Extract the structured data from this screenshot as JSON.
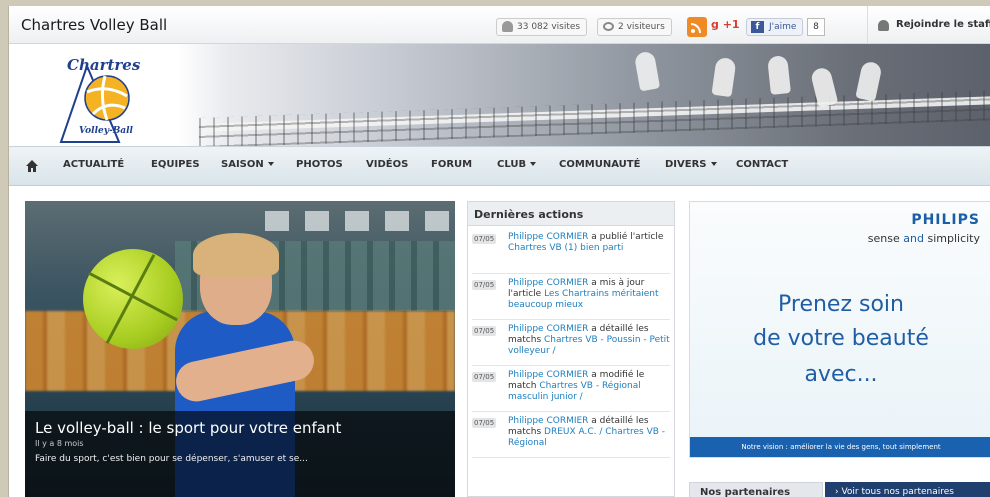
{
  "header": {
    "site_title": "Chartres Volley Ball",
    "visits": "33 082 visites",
    "visitors": "2 visiteurs",
    "gplus_label": "+1",
    "fb_like": "J'aime",
    "fb_count": "8",
    "join_label": "Rejoindre le staff"
  },
  "logo": {
    "top": "Chartres",
    "bottom": "Volley-Ball"
  },
  "nav": {
    "items": [
      {
        "label": "ACTUALITÉ"
      },
      {
        "label": "EQUIPES"
      },
      {
        "label": "SAISON"
      },
      {
        "label": "PHOTOS"
      },
      {
        "label": "VIDÉOS"
      },
      {
        "label": "FORUM"
      },
      {
        "label": "CLUB"
      },
      {
        "label": "COMMUNAUTÉ"
      },
      {
        "label": "DIVERS"
      },
      {
        "label": "CONTACT"
      }
    ]
  },
  "hero": {
    "title": "Le volley-ball : le sport pour votre enfant",
    "time": "Il y a 8 mois",
    "text": "Faire du sport, c'est bien pour se dépenser, s'amuser et se..."
  },
  "actions": {
    "heading": "Dernières actions",
    "items": [
      {
        "date": "07/05",
        "user": "Philippe CORMIER",
        "verb": " a publié l'article ",
        "target": "Chartres VB (1) bien parti"
      },
      {
        "date": "07/05",
        "user": "Philippe CORMIER",
        "verb": " a mis à jour l'article ",
        "target": "Les Chartrains méritaient beaucoup mieux"
      },
      {
        "date": "07/05",
        "user": "Philippe CORMIER",
        "verb": " a détaillé les matchs ",
        "target": "Chartres VB - Poussin - Petit volleyeur /"
      },
      {
        "date": "07/05",
        "user": "Philippe CORMIER",
        "verb": " a modifié le match ",
        "target": "Chartres VB - Régional masculin junior /"
      },
      {
        "date": "07/05",
        "user": "Philippe CORMIER",
        "verb": " a détaillé les matchs ",
        "target": "DREUX A.C. / Chartres VB - Régional"
      }
    ]
  },
  "ad": {
    "brand": "PHILIPS",
    "slogan_1": "sense ",
    "slogan_and": "and",
    "slogan_2": " simplicity",
    "line1": "Prenez soin",
    "line2": "de votre beauté",
    "line3": "avec...",
    "footer": "Notre vision : améliorer la vie des gens, tout simplement"
  },
  "partners": {
    "title": "Nos partenaires",
    "button": "Voir tous nos partenaires"
  },
  "colors": {
    "accent": "#1d7fc0",
    "nav_bg": "#dfe8ed",
    "brand_blue": "#1b5ea8"
  }
}
